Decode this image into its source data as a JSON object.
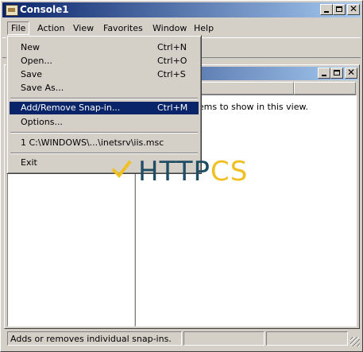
{
  "window": {
    "title": "Console1"
  },
  "menubar": {
    "items": [
      "File",
      "Action",
      "View",
      "Favorites",
      "Window",
      "Help"
    ]
  },
  "file_menu": {
    "items": [
      {
        "label": "New",
        "shortcut": "Ctrl+N"
      },
      {
        "label": "Open...",
        "shortcut": "Ctrl+O"
      },
      {
        "label": "Save",
        "shortcut": "Ctrl+S"
      },
      {
        "label": "Save As...",
        "shortcut": ""
      },
      {
        "label": "Add/Remove Snap-in...",
        "shortcut": "Ctrl+M",
        "highlighted": true
      },
      {
        "label": "Options...",
        "shortcut": ""
      },
      {
        "label": "1 C:\\WINDOWS\\...\\inetsrv\\iis.msc",
        "shortcut": ""
      },
      {
        "label": "Exit",
        "shortcut": ""
      }
    ]
  },
  "child_window": {
    "empty_message": "There are no items to show in this view."
  },
  "statusbar": {
    "text": "Adds or removes individual snap-ins."
  },
  "watermark": {
    "part1": "HTTP",
    "part2": "CS",
    "color1": "#1f4d63",
    "color2": "#f0c020"
  },
  "colors": {
    "title_active": "#0a246a",
    "menu_highlight": "#0a246a",
    "face": "#d4d0c8"
  }
}
